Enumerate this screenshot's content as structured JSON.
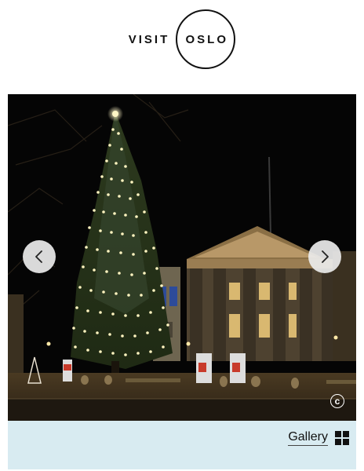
{
  "header": {
    "logo_visit": "VISIT",
    "logo_city": "OSLO"
  },
  "carousel": {
    "prev_icon": "chevron-left-icon",
    "next_icon": "chevron-right-icon",
    "copyright_symbol": "c"
  },
  "gallery": {
    "label": "Gallery",
    "icon": "grid-icon"
  },
  "colors": {
    "gallery_bar": "#d8ebf1",
    "text": "#111111"
  }
}
